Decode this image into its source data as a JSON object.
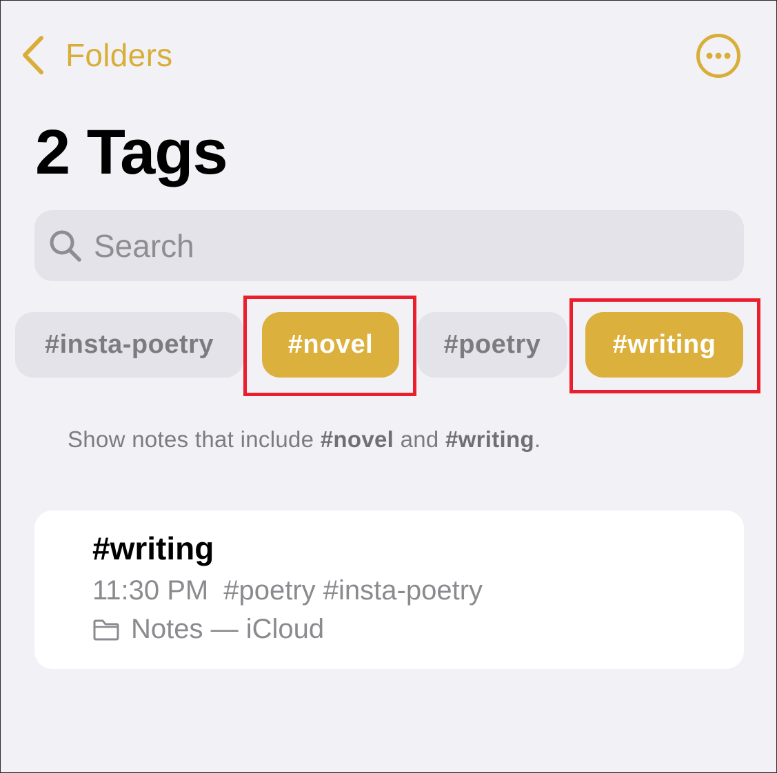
{
  "nav": {
    "back_label": "Folders"
  },
  "page": {
    "title": "2 Tags"
  },
  "search": {
    "placeholder": "Search"
  },
  "tags": [
    {
      "label": "#insta-poetry",
      "selected": false
    },
    {
      "label": "#novel",
      "selected": true
    },
    {
      "label": "#poetry",
      "selected": false
    },
    {
      "label": "#writing",
      "selected": true
    }
  ],
  "filter_caption": {
    "prefix": "Show notes that include ",
    "tag1": "#novel",
    "connector": " and ",
    "tag2": "#writing",
    "suffix": "."
  },
  "notes": [
    {
      "title": "#writing",
      "time": "11:30 PM",
      "tags": "#poetry #insta-poetry",
      "folder": "Notes — iCloud"
    }
  ],
  "colors": {
    "accent": "#d9ae38",
    "selected_chip": "#dcb03d",
    "highlight": "#eb1e2d",
    "background": "#f2f1f6"
  },
  "icons": {
    "back": "chevron-left-icon",
    "more": "ellipsis-circle-icon",
    "search": "magnifying-glass-icon",
    "folder": "folder-icon"
  }
}
